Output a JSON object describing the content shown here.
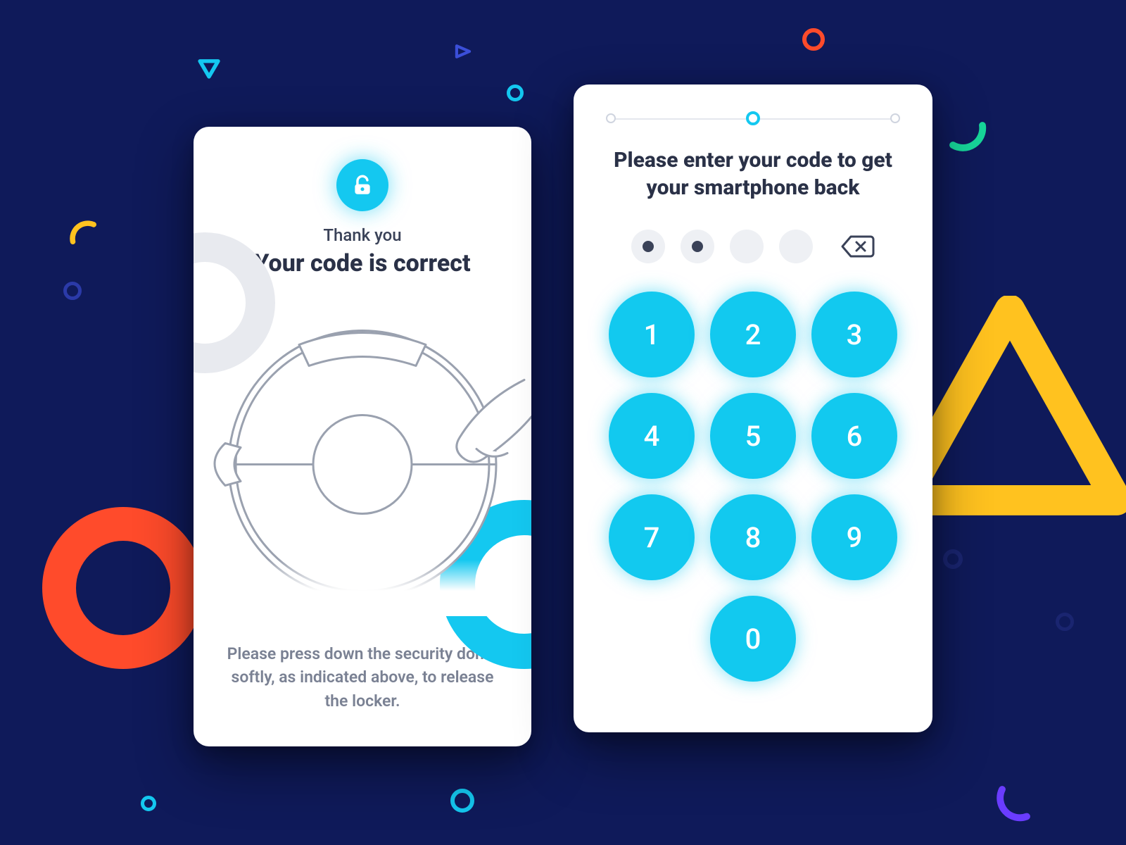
{
  "colors": {
    "accent": "#14c8f0",
    "dark": "#2a3147",
    "muted": "#7a8193",
    "bg": "#0f1a5a",
    "orange": "#ff4b2b",
    "yellow": "#ffc21f",
    "green": "#17d69a"
  },
  "success": {
    "thank_you": "Thank you",
    "headline": "Your code is correct",
    "instruction": "Please press down the security dome softly, as indicated above, to release the locker."
  },
  "keypad": {
    "title": "Please enter your code to get your smartphone back",
    "pin_length": 4,
    "pin_filled": 2,
    "keys": [
      "1",
      "2",
      "3",
      "4",
      "5",
      "6",
      "7",
      "8",
      "9",
      "0"
    ],
    "steps": {
      "total": 3,
      "active_index": 1
    }
  }
}
